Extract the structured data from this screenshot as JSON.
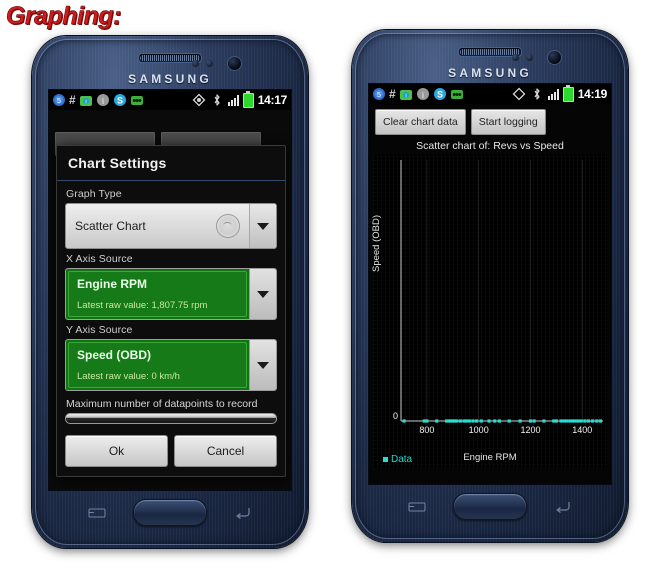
{
  "caption": "Graphing:",
  "phones": {
    "brand": "SAMSUNG",
    "left": {
      "statusbar": {
        "icons": [
          "sync-icon",
          "hash-icon",
          "app-green-icon",
          "info-icon",
          "skype-icon",
          "obd-icon",
          "gps-icon",
          "bluetooth-icon",
          "signal-icon",
          "battery-icon"
        ],
        "clock": "14:17"
      },
      "dialog": {
        "title": "Chart Settings",
        "graph_type_label": "Graph Type",
        "graph_type_value": "Scatter Chart",
        "x_axis_label": "X Axis Source",
        "x_axis_value": "Engine RPM",
        "x_axis_sub": "Latest raw value: 1,807.75 rpm",
        "y_axis_label": "Y Axis Source",
        "y_axis_value": "Speed (OBD)",
        "y_axis_sub": "Latest raw value: 0 km/h",
        "slider_label": "Maximum number of datapoints to record",
        "ok_label": "Ok",
        "cancel_label": "Cancel"
      }
    },
    "right": {
      "statusbar": {
        "clock": "14:19"
      },
      "toolbar": {
        "clear_label": "Clear chart data",
        "start_label": "Start logging"
      },
      "chart_data": {
        "type": "scatter",
        "title": "Scatter chart of: Revs vs Speed",
        "xlabel": "Engine RPM",
        "ylabel": "Speed (OBD)",
        "legend": "Data",
        "legend_position": "bottom-left",
        "grid": true,
        "series_color": "#25e0d2",
        "xticks": [
          800,
          1000,
          1200,
          1400
        ],
        "yticks": [
          0
        ],
        "xlim": [
          700,
          1480
        ],
        "ylim": [
          0,
          100
        ],
        "series": [
          {
            "name": "Data",
            "x": [
              712,
              790,
              800,
              838,
              876,
              886,
              892,
              900,
              908,
              916,
              930,
              944,
              952,
              964,
              978,
              992,
              1010,
              1040,
              1062,
              1080,
              1118,
              1160,
              1200,
              1214,
              1252,
              1290,
              1300,
              1318,
              1330,
              1340,
              1352,
              1362,
              1372,
              1384,
              1396,
              1410,
              1424,
              1440,
              1456,
              1470
            ],
            "y": [
              0,
              0,
              0,
              0,
              0,
              0,
              0,
              0,
              0,
              0,
              0,
              0,
              0,
              0,
              0,
              0,
              0,
              0,
              0,
              0,
              0,
              0,
              0,
              0,
              0,
              0,
              0,
              0,
              0,
              0,
              0,
              0,
              0,
              0,
              0,
              0,
              0,
              0,
              0,
              0
            ]
          }
        ]
      }
    }
  }
}
